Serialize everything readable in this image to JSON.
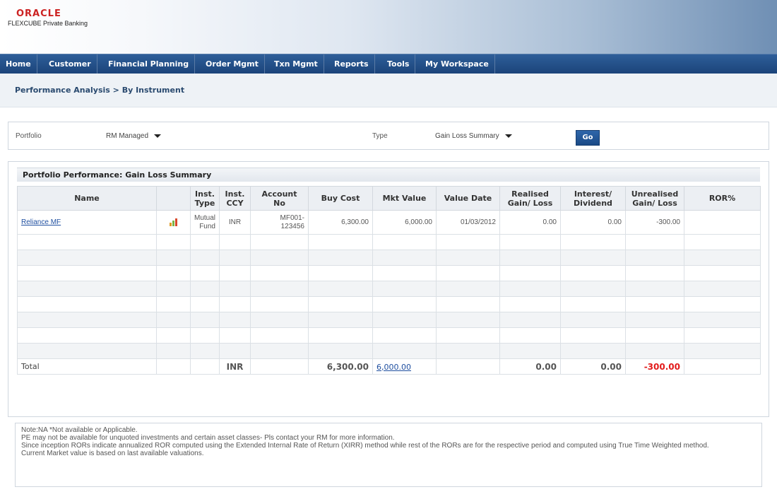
{
  "brand": {
    "name": "ORACLE",
    "product": "FLEXCUBE Private Banking"
  },
  "nav": [
    "Home",
    "Customer",
    "Financial Planning",
    "Order Mgmt",
    "Txn Mgmt",
    "Reports",
    "Tools",
    "My Workspace"
  ],
  "breadcrumb": "Performance Analysis > By Instrument",
  "filters": {
    "portfolio_label": "Portfolio",
    "portfolio_value": "RM Managed",
    "type_label": "Type",
    "type_value": "Gain Loss Summary",
    "go_label": "Go"
  },
  "panel": {
    "title": "Portfolio Performance: Gain Loss Summary",
    "headers": {
      "name": "Name",
      "inst_type_1": "Inst.",
      "inst_type_2": "Type",
      "inst_ccy_1": "Inst.",
      "inst_ccy_2": "CCY",
      "account_1": "Account",
      "account_2": "No",
      "buy_cost": "Buy Cost",
      "mkt_value": "Mkt Value",
      "value_date": "Value Date",
      "realised_1": "Realised",
      "realised_2": "Gain/ Loss",
      "interest_1": "Interest/",
      "interest_2": "Dividend",
      "unrealised_1": "Unrealised",
      "unrealised_2": "Gain/ Loss",
      "ror": "ROR%"
    },
    "row": {
      "name": "Reliance MF",
      "inst_type_1": "Mutual",
      "inst_type_2": "Fund",
      "ccy": "INR",
      "account_1": "MF001-",
      "account_2": "123456",
      "buy_cost": "6,300.00",
      "mkt_value": "6,000.00",
      "value_date": "01/03/2012",
      "realised": "0.00",
      "interest": "0.00",
      "unrealised": "-300.00",
      "ror": ""
    },
    "total": {
      "label": "Total",
      "ccy": "INR",
      "buy_cost": "6,300.00",
      "mkt_value": "6,000.00",
      "realised": "0.00",
      "interest": "0.00",
      "unrealised": "-300.00"
    }
  },
  "notes": [
    "Note:NA *Not available or Applicable.",
    "PE may not be available for unquoted investments and certain asset classes- Pls contact your RM for more information.",
    "Since inception RORs indicate annualized ROR computed using the Extended Internal Rate of Return (XIRR) method while rest of the RORs are for the respective period and computed using True Time Weighted method.",
    "Current Market value is based on last available valuations."
  ],
  "colors": {
    "nav_bg": "#1b447a",
    "negative": "#e21b1b",
    "link": "#1f4fa0",
    "brand_red": "#cc2222"
  }
}
